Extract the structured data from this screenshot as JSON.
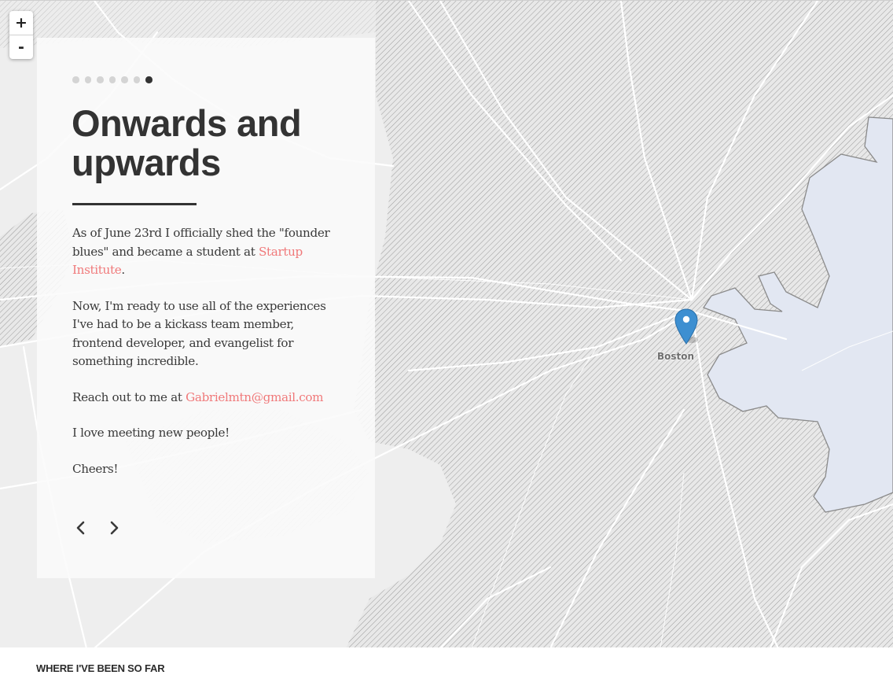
{
  "map": {
    "zoom_in_label": "+",
    "zoom_out_label": "-",
    "marker_label": "Boston"
  },
  "story": {
    "slide_count": 7,
    "active_slide": 7,
    "title": "Onwards and upwards",
    "p1_text": "As of June 23rd I officially shed the \"founder blues\" and became a student at ",
    "p1_link": "Startup Institute",
    "p1_end": ".",
    "p2": "Now, I'm ready to use all of the experiences I've had to be a kickass team member, frontend developer, and evangelist for something incredible.",
    "p3_text": "Reach out to me at ",
    "p3_link": "Gabrielmtn@gmail.com",
    "p4": "I love meeting new people!",
    "p5": "Cheers!"
  },
  "footer": {
    "title": "WHERE I'VE BEEN SO FAR"
  },
  "colors": {
    "accent_link": "#f0797a",
    "marker": "#3d8fd1",
    "water": "#e2e7f2",
    "land": "#eeeeee"
  }
}
